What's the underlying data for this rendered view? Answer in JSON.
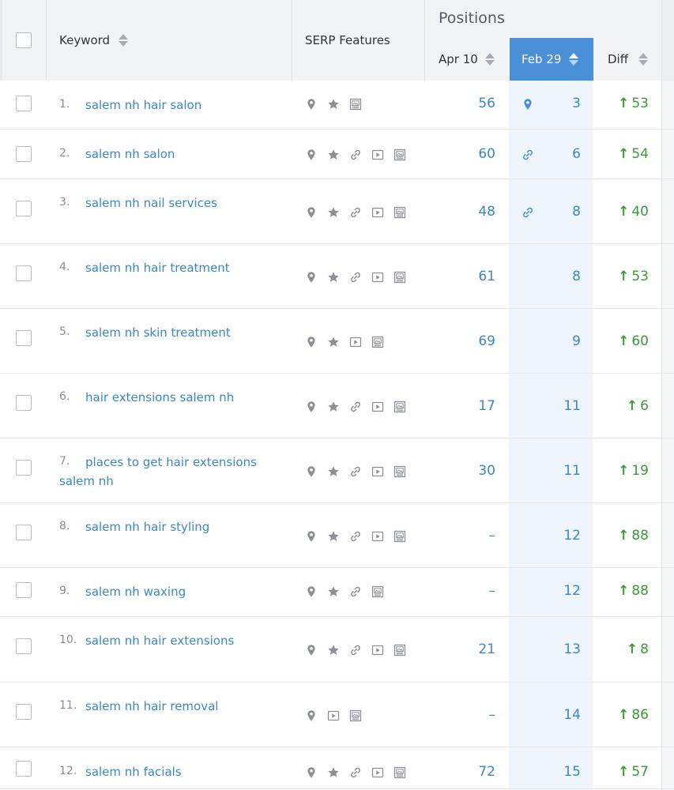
{
  "header": {
    "keyword_label": "Keyword",
    "serp_label": "SERP Features",
    "positions_label": "Positions",
    "date1_label": "Apr 10",
    "date2_label": "Feb 29",
    "diff_label": "Diff"
  },
  "colors": {
    "accent": "#4a90d9",
    "link": "#3a87c8",
    "positive": "#3a9a3a",
    "icon_gray": "#8c9096"
  },
  "rows": [
    {
      "num": "1.",
      "keyword": "salem nh hair salon",
      "serp": [
        "location-pin-icon",
        "star-icon",
        "image-icon"
      ],
      "apr": "56",
      "feb_icon": "location-pin-icon",
      "feb": "3",
      "diff": "53"
    },
    {
      "num": "2.",
      "keyword": "salem nh salon",
      "serp": [
        "location-pin-icon",
        "star-icon",
        "link-icon",
        "video-icon",
        "image-icon"
      ],
      "apr": "60",
      "feb_icon": "link-icon",
      "feb": "6",
      "diff": "54"
    },
    {
      "num": "3.",
      "keyword": "salem nh nail services",
      "serp": [
        "location-pin-icon",
        "star-icon",
        "link-icon",
        "video-icon",
        "image-icon"
      ],
      "apr": "48",
      "feb_icon": "link-icon",
      "feb": "8",
      "diff": "40"
    },
    {
      "num": "4.",
      "keyword": "salem nh hair treatment",
      "serp": [
        "location-pin-icon",
        "star-icon",
        "link-icon",
        "video-icon",
        "image-icon"
      ],
      "apr": "61",
      "feb_icon": "",
      "feb": "8",
      "diff": "53"
    },
    {
      "num": "5.",
      "keyword": "salem nh skin treatment",
      "serp": [
        "location-pin-icon",
        "star-icon",
        "video-icon",
        "image-icon"
      ],
      "apr": "69",
      "feb_icon": "",
      "feb": "9",
      "diff": "60"
    },
    {
      "num": "6.",
      "keyword": "hair extensions salem nh",
      "serp": [
        "location-pin-icon",
        "star-icon",
        "link-icon",
        "video-icon",
        "image-icon"
      ],
      "apr": "17",
      "feb_icon": "",
      "feb": "11",
      "diff": "6"
    },
    {
      "num": "7.",
      "keyword": "places to get hair extensions salem nh",
      "serp": [
        "location-pin-icon",
        "star-icon",
        "link-icon",
        "video-icon",
        "image-icon"
      ],
      "apr": "30",
      "feb_icon": "",
      "feb": "11",
      "diff": "19"
    },
    {
      "num": "8.",
      "keyword": "salem nh hair styling",
      "serp": [
        "location-pin-icon",
        "star-icon",
        "link-icon",
        "video-icon",
        "image-icon"
      ],
      "apr": "–",
      "feb_icon": "",
      "feb": "12",
      "diff": "88"
    },
    {
      "num": "9.",
      "keyword": "salem nh waxing",
      "serp": [
        "location-pin-icon",
        "star-icon",
        "link-icon",
        "image-icon"
      ],
      "apr": "–",
      "feb_icon": "",
      "feb": "12",
      "diff": "88"
    },
    {
      "num": "10.",
      "keyword": "salem nh hair extensions",
      "serp": [
        "location-pin-icon",
        "star-icon",
        "link-icon",
        "video-icon",
        "image-icon"
      ],
      "apr": "21",
      "feb_icon": "",
      "feb": "13",
      "diff": "8"
    },
    {
      "num": "11.",
      "keyword": "salem nh hair removal",
      "serp": [
        "location-pin-icon",
        "video-icon",
        "image-icon"
      ],
      "apr": "–",
      "feb_icon": "",
      "feb": "14",
      "diff": "86"
    },
    {
      "num": "12.",
      "keyword": "salem nh facials",
      "serp": [
        "location-pin-icon",
        "star-icon",
        "link-icon",
        "video-icon",
        "image-icon"
      ],
      "apr": "72",
      "feb_icon": "",
      "feb": "15",
      "diff": "57"
    }
  ]
}
